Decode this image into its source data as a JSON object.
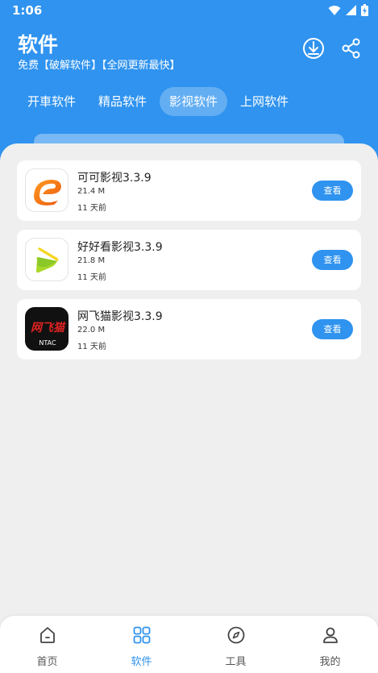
{
  "status": {
    "time": "1:06",
    "icons": [
      "wifi-icon",
      "cell-signal-icon",
      "battery-icon"
    ]
  },
  "header": {
    "title": "软件",
    "subtitle": "免费【破解软件】【全网更新最快】",
    "buttons": [
      "download-icon",
      "share-icon"
    ]
  },
  "tabs": [
    {
      "label": "开車软件",
      "active": false
    },
    {
      "label": "精品软件",
      "active": false
    },
    {
      "label": "影视软件",
      "active": true
    },
    {
      "label": "上网软件",
      "active": false
    }
  ],
  "apps": [
    {
      "name": "可可影视3.3.9",
      "size": "21.4 M",
      "time": "11 天前",
      "button": "查看",
      "icon": "keke-logo-icon"
    },
    {
      "name": "好好看影视3.3.9",
      "size": "21.8 M",
      "time": "11 天前",
      "button": "查看",
      "icon": "haohaokan-logo-icon"
    },
    {
      "name": "网飞猫影视3.3.9",
      "size": "22.0 M",
      "time": "11 天前",
      "button": "查看",
      "icon": "ntac-logo-icon",
      "logo_text": "网飞猫",
      "logo_subtext": "NTAC"
    }
  ],
  "nav": [
    {
      "label": "首页",
      "icon": "home-icon",
      "active": false
    },
    {
      "label": "软件",
      "icon": "grid-icon",
      "active": true
    },
    {
      "label": "工具",
      "icon": "compass-icon",
      "active": false
    },
    {
      "label": "我的",
      "icon": "user-icon",
      "active": false
    }
  ],
  "colors": {
    "primary": "#2f93ef",
    "background": "#efefef",
    "card": "#ffffff"
  }
}
